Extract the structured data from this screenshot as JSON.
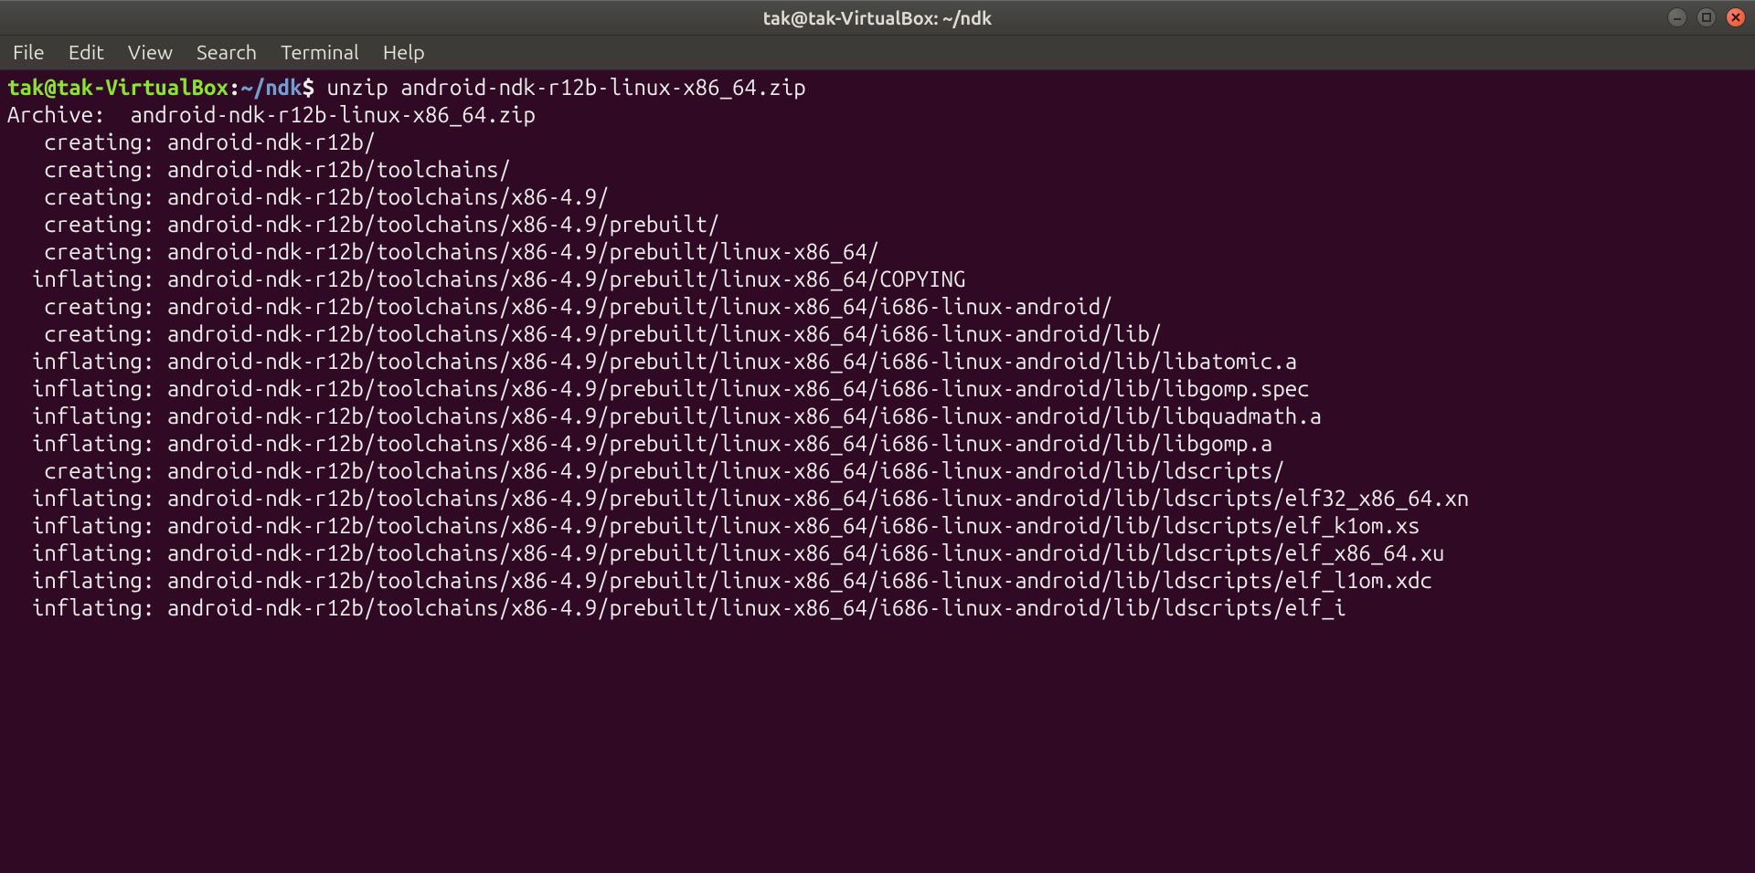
{
  "window": {
    "title": "tak@tak-VirtualBox: ~/ndk"
  },
  "menubar": {
    "items": [
      "File",
      "Edit",
      "View",
      "Search",
      "Terminal",
      "Help"
    ]
  },
  "prompt": {
    "user_host": "tak@tak-VirtualBox",
    "colon": ":",
    "path": "~/ndk",
    "dollar": "$"
  },
  "command": " unzip android-ndk-r12b-linux-x86_64.zip",
  "output": [
    "Archive:  android-ndk-r12b-linux-x86_64.zip",
    "   creating: android-ndk-r12b/",
    "   creating: android-ndk-r12b/toolchains/",
    "   creating: android-ndk-r12b/toolchains/x86-4.9/",
    "   creating: android-ndk-r12b/toolchains/x86-4.9/prebuilt/",
    "   creating: android-ndk-r12b/toolchains/x86-4.9/prebuilt/linux-x86_64/",
    "  inflating: android-ndk-r12b/toolchains/x86-4.9/prebuilt/linux-x86_64/COPYING",
    "   creating: android-ndk-r12b/toolchains/x86-4.9/prebuilt/linux-x86_64/i686-linux-android/",
    "   creating: android-ndk-r12b/toolchains/x86-4.9/prebuilt/linux-x86_64/i686-linux-android/lib/",
    "  inflating: android-ndk-r12b/toolchains/x86-4.9/prebuilt/linux-x86_64/i686-linux-android/lib/libatomic.a",
    "  inflating: android-ndk-r12b/toolchains/x86-4.9/prebuilt/linux-x86_64/i686-linux-android/lib/libgomp.spec",
    "  inflating: android-ndk-r12b/toolchains/x86-4.9/prebuilt/linux-x86_64/i686-linux-android/lib/libquadmath.a",
    "  inflating: android-ndk-r12b/toolchains/x86-4.9/prebuilt/linux-x86_64/i686-linux-android/lib/libgomp.a",
    "   creating: android-ndk-r12b/toolchains/x86-4.9/prebuilt/linux-x86_64/i686-linux-android/lib/ldscripts/",
    "  inflating: android-ndk-r12b/toolchains/x86-4.9/prebuilt/linux-x86_64/i686-linux-android/lib/ldscripts/elf32_x86_64.xn",
    "  inflating: android-ndk-r12b/toolchains/x86-4.9/prebuilt/linux-x86_64/i686-linux-android/lib/ldscripts/elf_k1om.xs",
    "  inflating: android-ndk-r12b/toolchains/x86-4.9/prebuilt/linux-x86_64/i686-linux-android/lib/ldscripts/elf_x86_64.xu",
    "  inflating: android-ndk-r12b/toolchains/x86-4.9/prebuilt/linux-x86_64/i686-linux-android/lib/ldscripts/elf_l1om.xdc",
    "  inflating: android-ndk-r12b/toolchains/x86-4.9/prebuilt/linux-x86_64/i686-linux-android/lib/ldscripts/elf_i"
  ]
}
